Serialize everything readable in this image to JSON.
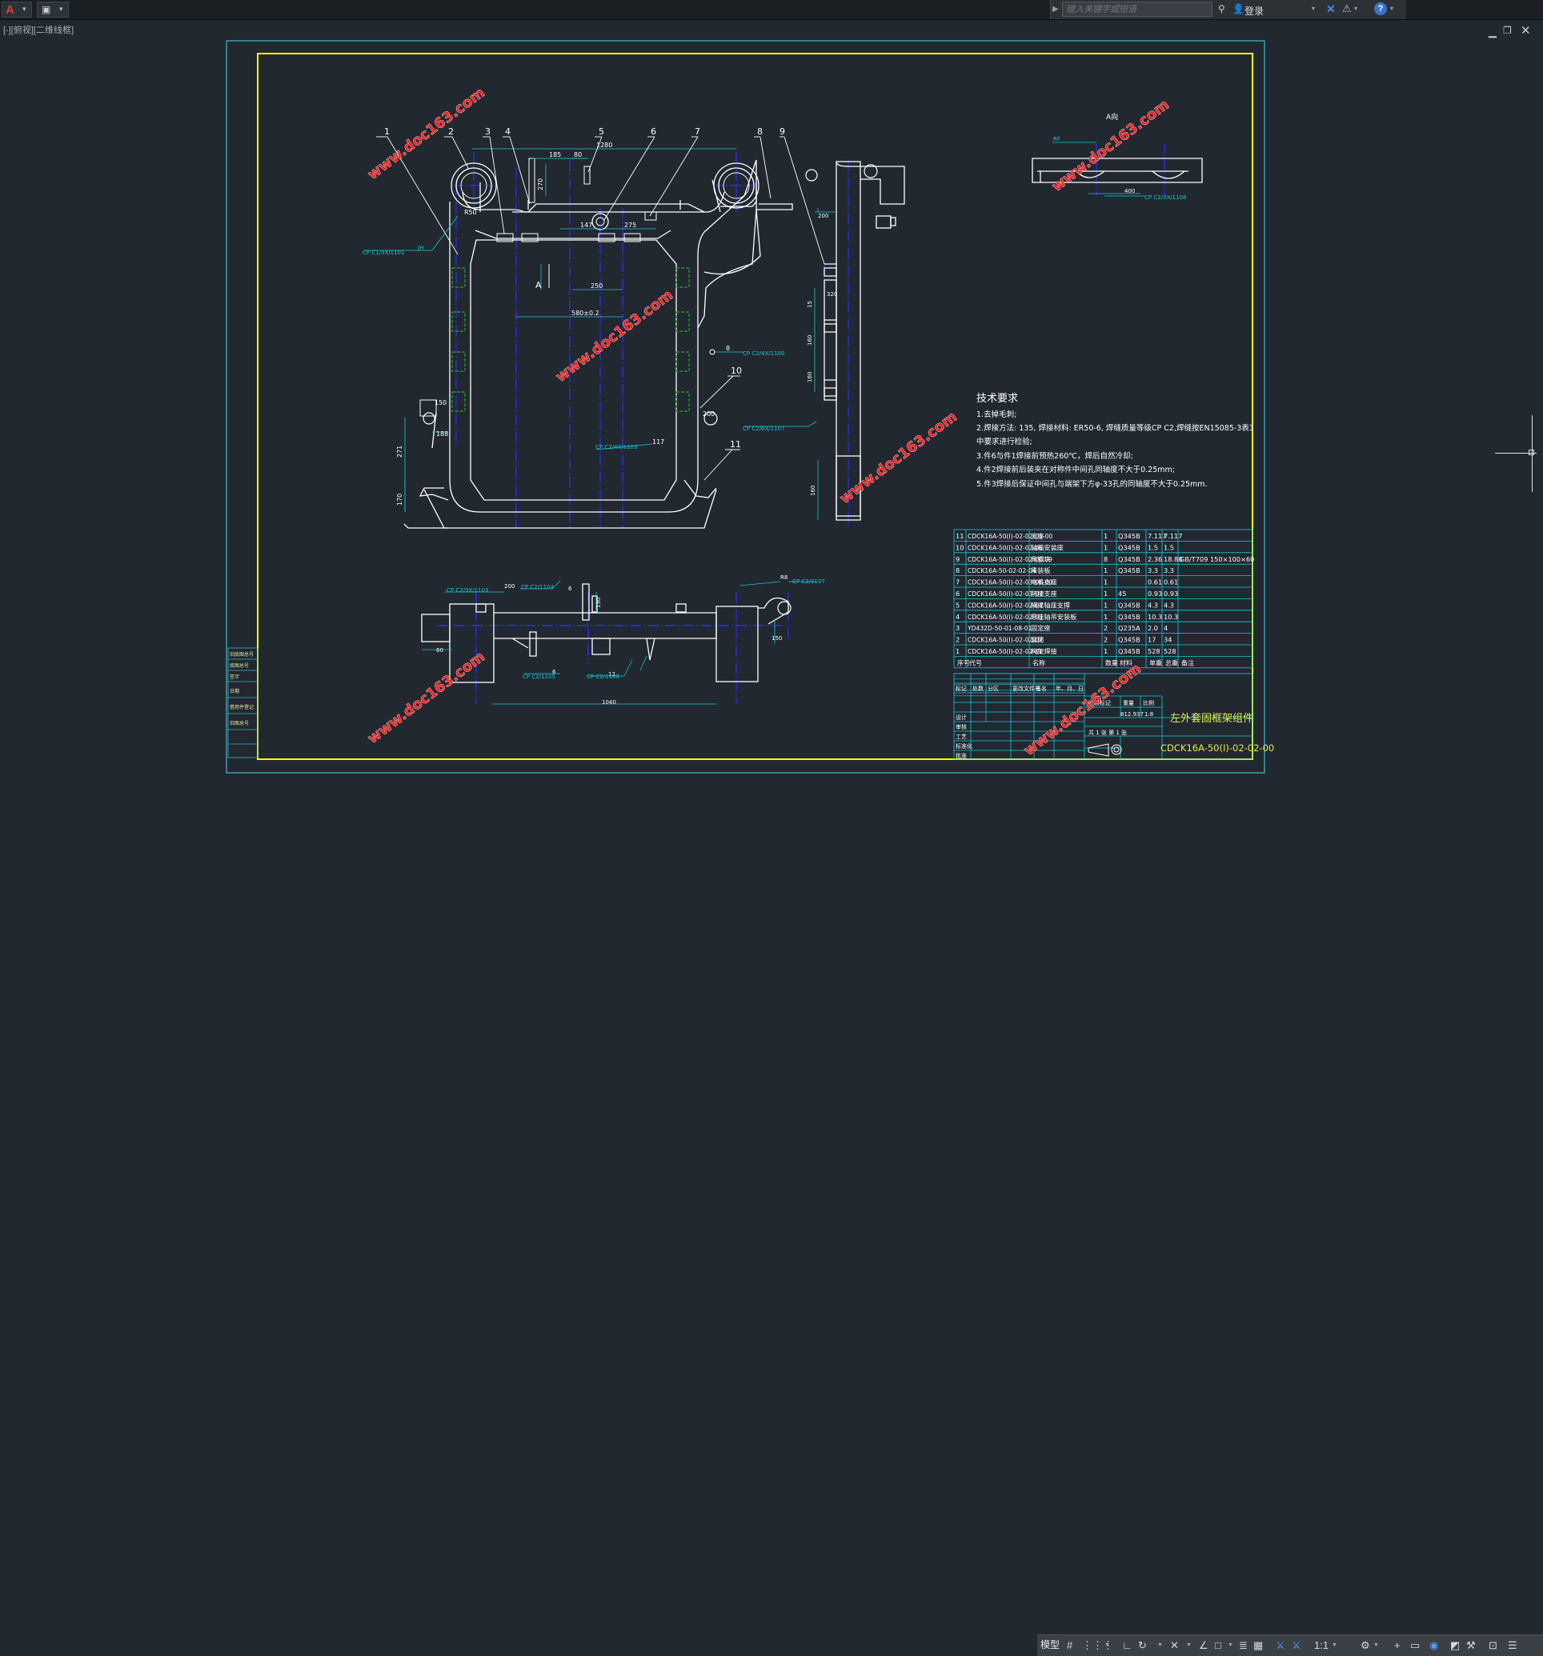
{
  "topbar": {
    "search_placeholder": "键入关键字或短语",
    "login_label": "登录"
  },
  "viewport": {
    "label": "[-][俯视][二维线框]"
  },
  "watermark": {
    "text": "www.doc163.com"
  },
  "drawing": {
    "balloons": [
      "1",
      "2",
      "3",
      "4",
      "5",
      "6",
      "7",
      "8",
      "9",
      "10",
      "11"
    ],
    "view_label_a": "A",
    "view_label_a_dir": "A向",
    "dims": [
      "1280",
      "185",
      "80",
      "270",
      "147",
      "275",
      "250",
      "580±0.2",
      "R50",
      "40",
      "271",
      "170",
      "188",
      "150",
      "200",
      "15",
      "160",
      "160",
      "160",
      "320",
      "400",
      "150",
      "200",
      "130",
      "150",
      "1040",
      "60",
      "150",
      "R8",
      "6",
      "117",
      "200",
      "8",
      "12"
    ],
    "weld_labels": [
      "CP C1/3X/1101",
      "CP C2/4X/1100",
      "CP C2/6X/1107",
      "CP C2/4X/1103",
      "CP C2/3X/1106",
      "CP C2/3X/1103",
      "CP C2/1104",
      "CP C2/1105",
      "CP C2/1108",
      "CP C2/1107",
      "CP C2/1105"
    ],
    "small_text": [
      "JH",
      "RF"
    ],
    "tech_title": "技术要求",
    "tech_lines": [
      "1.去掉毛刺;",
      "2.焊接方法: 135, 焊接材料: ER50-6, 焊缝质量等级CP C2,焊缝按EN15085-3表3",
      "中要求进行检验;",
      "3.件6与件1焊接前预热260℃，焊后自然冷却;",
      "4.件2焊接前后装夹在对称件中间孔同轴度不大于0.25mm;",
      "5.件3焊接后保证中间孔与端架下方φ-33孔的同轴度不大于0.25mm."
    ],
    "bom_rows": [
      [
        "11",
        "CDCK16A-50(I)-02-02-05-00",
        "支座",
        "1",
        "Q345B",
        "7.117",
        "7.117",
        ""
      ],
      [
        "10",
        "CDCK16A-50(I)-02-02-05",
        "轴箱安装座",
        "1",
        "Q345B",
        "1.5",
        "1.5",
        ""
      ],
      [
        "9",
        "CDCK16A-50(I)-02-02-00.09",
        "角钢块",
        "8",
        "Q345B",
        "2.36",
        "18.88",
        "GB/T709 150×100×60"
      ],
      [
        "8",
        "CDCK16A-50-02-02-04",
        "吊装板",
        "1",
        "Q345B",
        "3.3",
        "3.3",
        ""
      ],
      [
        "7",
        "CDCK16A-50(I)-02-03-06-00",
        "电机支座",
        "1",
        "",
        "0.61",
        "0.61",
        ""
      ],
      [
        "6",
        "CDCK16A-50(I)-02-03-07",
        "防撞支座",
        "1",
        "45",
        "0.93",
        "0.93",
        ""
      ],
      [
        "5",
        "CDCK16A-50(I)-02-02-04",
        "横梁轴座支撑",
        "1",
        "Q345B",
        "4.3",
        "4.3",
        ""
      ],
      [
        "4",
        "CDCK16A-50(I)-02-02-03",
        "悬挂轴吊安装板",
        "1",
        "Q345B",
        "10.3",
        "10.3",
        ""
      ],
      [
        "3",
        "YD432D-50-01-08-01",
        "固定座",
        "2",
        "Q235A",
        "2.0",
        "4",
        ""
      ],
      [
        "2",
        "CDCK16A-50(I)-02-02-02",
        "套筒",
        "2",
        "Q345B",
        "17",
        "34",
        ""
      ],
      [
        "1",
        "CDCK16A-50(I)-02-02-01",
        "构架焊接",
        "1",
        "Q345B",
        "528",
        "528",
        ""
      ]
    ],
    "bom_header": [
      "序号",
      "代号",
      "名称",
      "数量",
      "材料",
      "单重",
      "总重",
      "备注"
    ],
    "title_part_name": "左外套固框架组件",
    "title_drawing_no": "CDCK16A-50(I)-02-02-00",
    "title_stage_label": "阶段标记",
    "title_weight_label": "重量",
    "title_scale_label": "比例",
    "title_weight": "812.937",
    "title_scale": "1:8",
    "title_sheet": "共 1 张  第 1 张",
    "title_rows": [
      "标记",
      "处数",
      "分区",
      "更改文件号",
      "签名",
      "年、月、日"
    ],
    "title_roles": [
      "设计",
      "审核",
      "工艺",
      "标准化",
      "批准"
    ],
    "left_strip": [
      "旧底图总号",
      "底图总号",
      "签字",
      "日期",
      "借用件登记",
      "旧图总号"
    ]
  },
  "statusbar": {
    "model_tab": "模型",
    "scale": "1:1"
  },
  "colors": {
    "canvas": "#212830",
    "outer_border": "#3fb0c2",
    "inner_border": "#ffff00",
    "geometry": "#ffffff",
    "dimension": "#19c8d6",
    "centerline": "#3030ff",
    "hatch": "#2aa52a",
    "watermark": "#ff1a1a"
  }
}
